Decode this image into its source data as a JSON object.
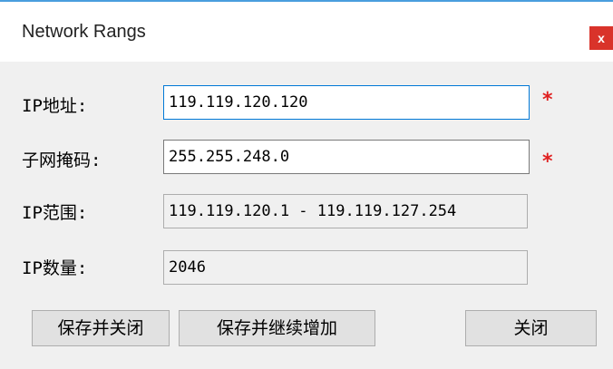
{
  "dialog": {
    "title": "Network Rangs",
    "close_label": "x"
  },
  "form": {
    "ip_address": {
      "label": "IP地址:",
      "value": "119.119.120.120",
      "required_mark": "*"
    },
    "subnet_mask": {
      "label": "子网掩码:",
      "value": "255.255.248.0",
      "required_mark": "*"
    },
    "ip_range": {
      "label": "IP范围:",
      "value": "119.119.120.1 - 119.119.127.254"
    },
    "ip_count": {
      "label": "IP数量:",
      "value": "2046"
    }
  },
  "buttons": {
    "save_close": "保存并关闭",
    "save_continue": "保存并继续增加",
    "close": "关闭"
  },
  "colors": {
    "accent": "#0078d7",
    "close_button": "#d9332a",
    "required": "#e02020",
    "top_line": "#4a9ede"
  }
}
